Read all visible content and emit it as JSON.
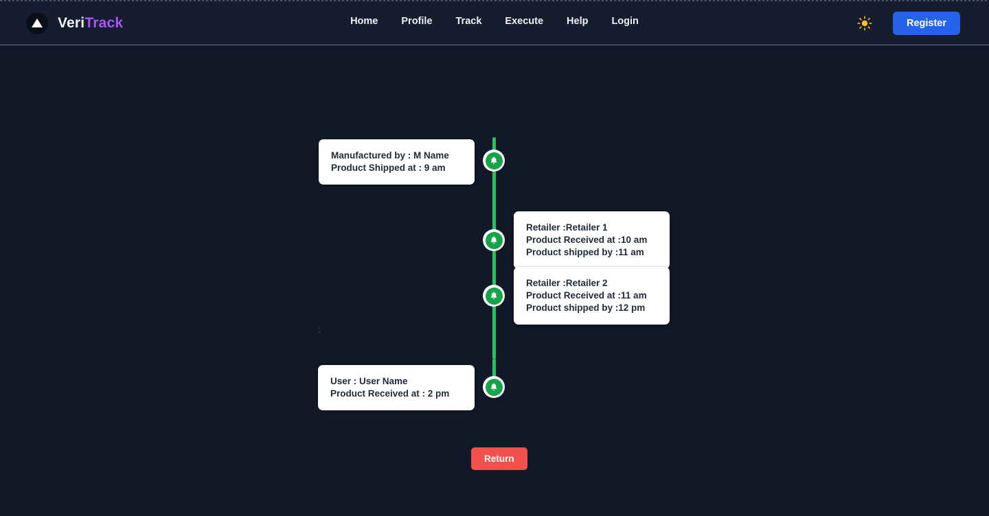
{
  "theme": {
    "page_bg": "#111827",
    "header_bg": "#161d2e",
    "accent_purple": "#a855f7",
    "accent_blue": "#2563eb",
    "timeline_green": "#22c55e",
    "return_red": "#f4504e",
    "card_bg": "#ffffff",
    "card_text": "#1f2937"
  },
  "header": {
    "brand": {
      "veri": "Veri",
      "track": "Track",
      "logo_icon": "triangle-logo-icon"
    },
    "nav": [
      {
        "label": "Home"
      },
      {
        "label": "Profile"
      },
      {
        "label": "Track"
      },
      {
        "label": "Execute"
      },
      {
        "label": "Help"
      },
      {
        "label": "Login"
      }
    ],
    "theme_toggle_icon": "sun-icon",
    "register_label": "Register"
  },
  "timeline": {
    "marker_icon": "bell-icon",
    "steps": [
      {
        "id": "manufacturer",
        "side": "left",
        "lines": [
          "Manufactured by : M Name",
          "Product Shipped at : 9 am"
        ]
      },
      {
        "id": "retailer-1",
        "side": "right",
        "lines": [
          "Retailer :Retailer 1",
          "Product Received at :10 am",
          "Product shipped by :11 am"
        ]
      },
      {
        "id": "retailer-2",
        "side": "right",
        "lines": [
          "Retailer :Retailer 2",
          "Product Received at :11 am",
          "Product shipped by :12 pm"
        ]
      },
      {
        "id": "user",
        "side": "left",
        "lines": [
          "User : User Name",
          "Product Received at : 2 pm"
        ]
      }
    ],
    "stray_text": ";"
  },
  "footer": {
    "return_label": "Return"
  }
}
